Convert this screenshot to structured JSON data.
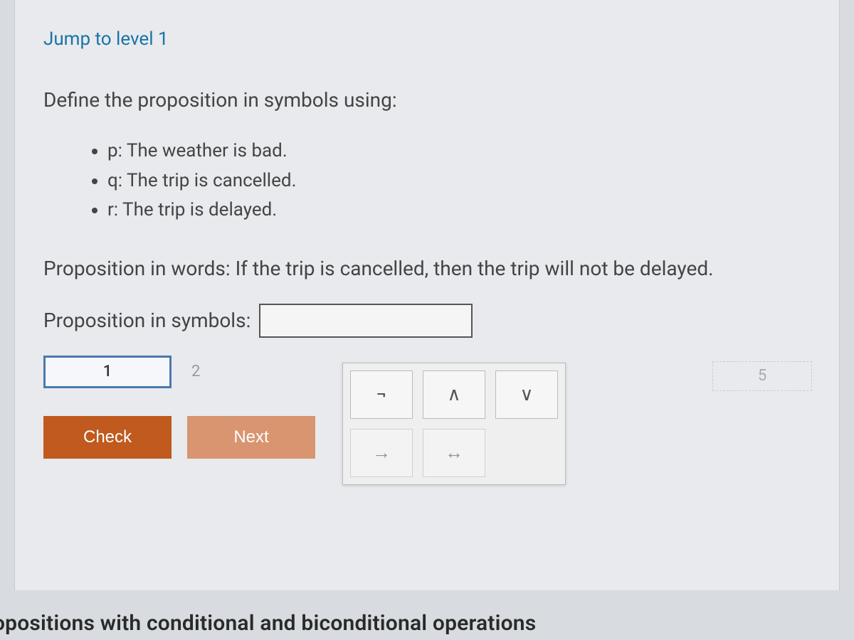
{
  "jump": "Jump to level 1",
  "prompt": "Define the proposition in symbols using:",
  "propositions": {
    "p": "p: The weather is bad.",
    "q": "q: The trip is cancelled.",
    "r": "r: The trip is delayed."
  },
  "words": "Proposition in words: If the trip is cancelled, then the trip will not be delayed.",
  "symbols_label": "Proposition in symbols:",
  "symbols_value": "",
  "levels": {
    "active": "1",
    "next": "2",
    "far": "5"
  },
  "buttons": {
    "check": "Check",
    "next": "Next"
  },
  "palette": {
    "not": "¬",
    "and": "∧",
    "or": "∨",
    "implies": "→",
    "iff": "↔"
  },
  "footer": "opositions with conditional and biconditional operations"
}
